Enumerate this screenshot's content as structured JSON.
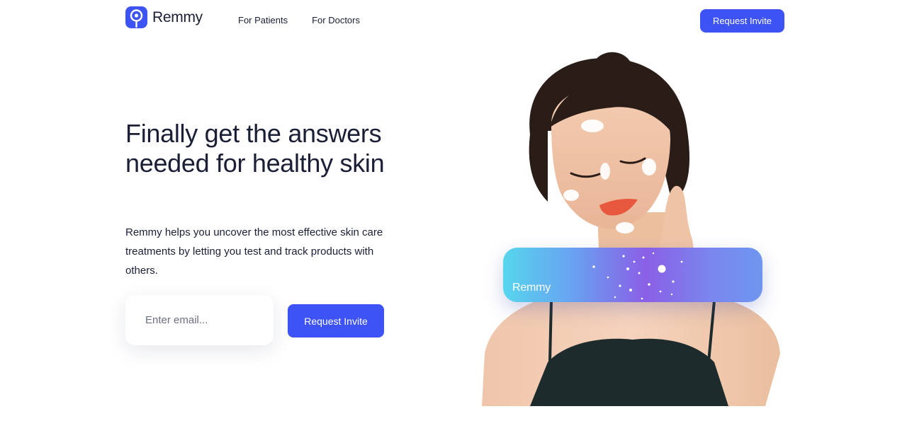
{
  "brand": {
    "name": "Remmy",
    "accent_color": "#3d53f5"
  },
  "nav": {
    "links": [
      {
        "label": "For Patients"
      },
      {
        "label": "For Doctors"
      }
    ],
    "cta_label": "Request Invite"
  },
  "hero": {
    "title": "Finally get the answers needed for healthy skin",
    "description": "Remmy helps you uncover the most effective skin care treatments by letting you test and track products with others.",
    "email_placeholder": "Enter email...",
    "cta_label": "Request Invite"
  },
  "card": {
    "label": "Remmy"
  }
}
